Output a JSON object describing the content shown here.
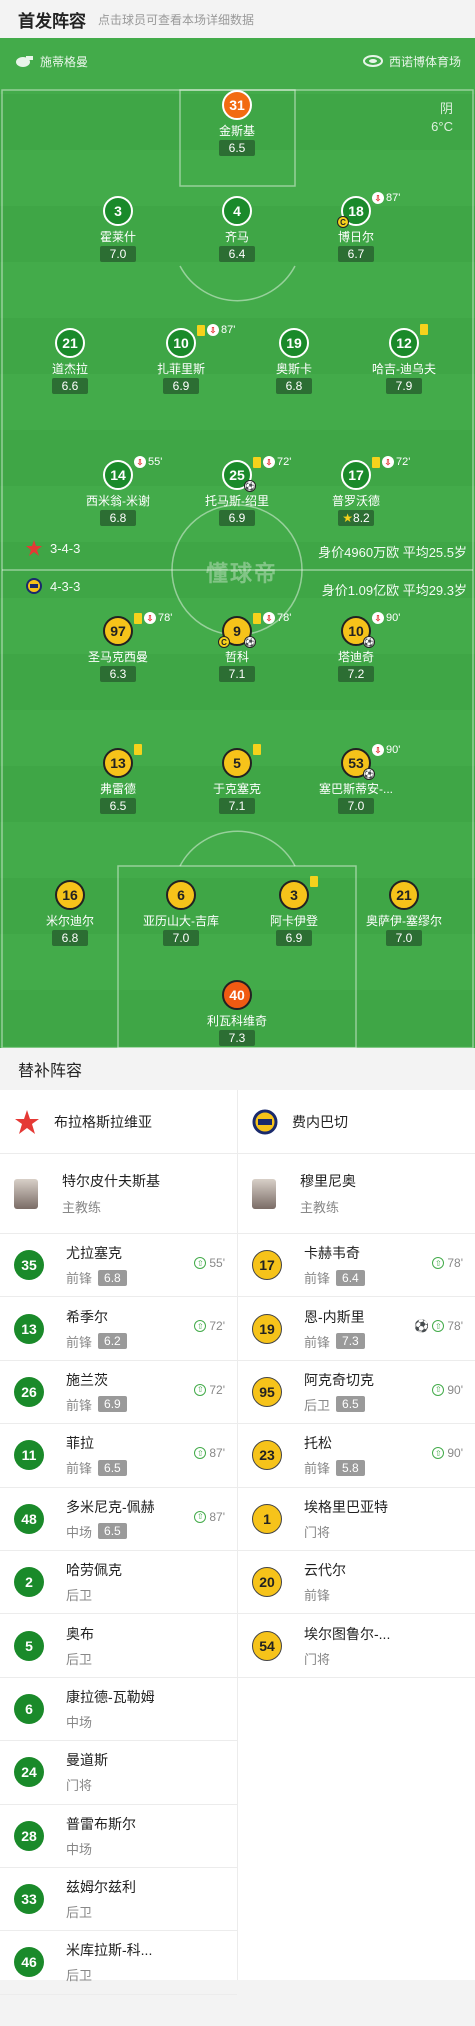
{
  "header": {
    "title": "首发阵容",
    "hint": "点击球员可查看本场详细数据"
  },
  "top_bar": {
    "coach_label": "施蒂格曼",
    "stadium": "西诺博体育场"
  },
  "weather": {
    "condition": "阴",
    "temperature": "6°C"
  },
  "watermark": "懂球帝",
  "home": {
    "team": "布拉格斯拉维亚",
    "formation": "3-4-3",
    "value_summary": "身价4960万欧 平均25.5岁",
    "players": [
      {
        "number": "31",
        "name": "金斯基",
        "rating": "6.5",
        "gk": true
      },
      {
        "number": "3",
        "name": "霍莱什",
        "rating": "7.0"
      },
      {
        "number": "4",
        "name": "齐马",
        "rating": "6.4"
      },
      {
        "number": "18",
        "name": "博日尔",
        "rating": "6.7",
        "events": {
          "sub": "87'"
        },
        "captain": true
      },
      {
        "number": "21",
        "name": "道杰拉",
        "rating": "6.6"
      },
      {
        "number": "10",
        "name": "扎菲里斯",
        "rating": "6.9",
        "events": {
          "yellow": true,
          "sub": "87'"
        }
      },
      {
        "number": "19",
        "name": "奥斯卡",
        "rating": "6.8"
      },
      {
        "number": "12",
        "name": "哈吉-迪乌夫",
        "rating": "7.9",
        "events": {
          "yellow": true
        }
      },
      {
        "number": "14",
        "name": "西米翁-米谢",
        "rating": "6.8",
        "events": {
          "sub": "55'"
        }
      },
      {
        "number": "25",
        "name": "托马斯-绍里",
        "rating": "6.9",
        "events": {
          "yellow": true,
          "sub": "72'"
        },
        "ball": true
      },
      {
        "number": "17",
        "name": "普罗沃德",
        "rating": "8.2",
        "events": {
          "yellow": true,
          "sub": "72'"
        },
        "best": true
      }
    ]
  },
  "away": {
    "team": "费内巴切",
    "formation": "4-3-3",
    "value_summary": "身价1.09亿欧 平均29.3岁",
    "players": [
      {
        "number": "97",
        "name": "圣马克西曼",
        "rating": "6.3",
        "events": {
          "yellow": true,
          "sub": "78'"
        }
      },
      {
        "number": "9",
        "name": "哲科",
        "rating": "7.1",
        "events": {
          "yellow": true,
          "sub": "78'"
        },
        "captain": true,
        "ball": true
      },
      {
        "number": "10",
        "name": "塔迪奇",
        "rating": "7.2",
        "events": {
          "sub": "90'"
        },
        "ball": true
      },
      {
        "number": "13",
        "name": "弗雷德",
        "rating": "6.5",
        "events": {
          "yellow": true
        }
      },
      {
        "number": "5",
        "name": "于克塞克",
        "rating": "7.1",
        "events": {
          "yellow": true
        }
      },
      {
        "number": "53",
        "name": "塞巴斯蒂安-...",
        "rating": "7.0",
        "events": {
          "sub": "90'"
        },
        "ball": true
      },
      {
        "number": "16",
        "name": "米尔迪尔",
        "rating": "6.8"
      },
      {
        "number": "6",
        "name": "亚历山大-吉库",
        "rating": "7.0"
      },
      {
        "number": "3",
        "name": "阿卡伊登",
        "rating": "6.9",
        "events": {
          "yellow": true
        }
      },
      {
        "number": "21",
        "name": "奥萨伊-塞缪尔",
        "rating": "7.0"
      },
      {
        "number": "40",
        "name": "利瓦科维奇",
        "rating": "7.3",
        "gk": true
      }
    ]
  },
  "subs_title": "替补阵容",
  "subs": {
    "home": {
      "team": "布拉格斯拉维亚",
      "coach": {
        "name": "特尔皮什夫斯基",
        "role": "主教练"
      },
      "players": [
        {
          "number": "35",
          "name": "尤拉塞克",
          "position": "前锋",
          "rating": "6.8",
          "in": "55'"
        },
        {
          "number": "13",
          "name": "希季尔",
          "position": "前锋",
          "rating": "6.2",
          "in": "72'"
        },
        {
          "number": "26",
          "name": "施兰茨",
          "position": "前锋",
          "rating": "6.9",
          "in": "72'"
        },
        {
          "number": "11",
          "name": "菲拉",
          "position": "前锋",
          "rating": "6.5",
          "in": "87'"
        },
        {
          "number": "48",
          "name": "多米尼克-佩赫",
          "position": "中场",
          "rating": "6.5",
          "in": "87'"
        },
        {
          "number": "2",
          "name": "哈劳佩克",
          "position": "后卫"
        },
        {
          "number": "5",
          "name": "奥布",
          "position": "后卫"
        },
        {
          "number": "6",
          "name": "康拉德-瓦勒姆",
          "position": "中场"
        },
        {
          "number": "24",
          "name": "曼道斯",
          "position": "门将"
        },
        {
          "number": "28",
          "name": "普雷布斯尔",
          "position": "中场"
        },
        {
          "number": "33",
          "name": "兹姆尔兹利",
          "position": "后卫"
        },
        {
          "number": "46",
          "name": "米库拉斯-科...",
          "position": "后卫"
        }
      ]
    },
    "away": {
      "team": "费内巴切",
      "coach": {
        "name": "穆里尼奥",
        "role": "主教练"
      },
      "players": [
        {
          "number": "17",
          "name": "卡赫韦奇",
          "position": "前锋",
          "rating": "6.4",
          "in": "78'"
        },
        {
          "number": "19",
          "name": "恩-内斯里",
          "position": "前锋",
          "rating": "7.3",
          "in": "78'",
          "goal": true
        },
        {
          "number": "95",
          "name": "阿克奇切克",
          "position": "后卫",
          "rating": "6.5",
          "in": "90'"
        },
        {
          "number": "23",
          "name": "托松",
          "position": "前锋",
          "rating": "5.8",
          "in": "90'"
        },
        {
          "number": "1",
          "name": "埃格里巴亚特",
          "position": "门将"
        },
        {
          "number": "20",
          "name": "云代尔",
          "position": "前锋"
        },
        {
          "number": "54",
          "name": "埃尔图鲁尔-...",
          "position": "门将"
        }
      ]
    }
  }
}
